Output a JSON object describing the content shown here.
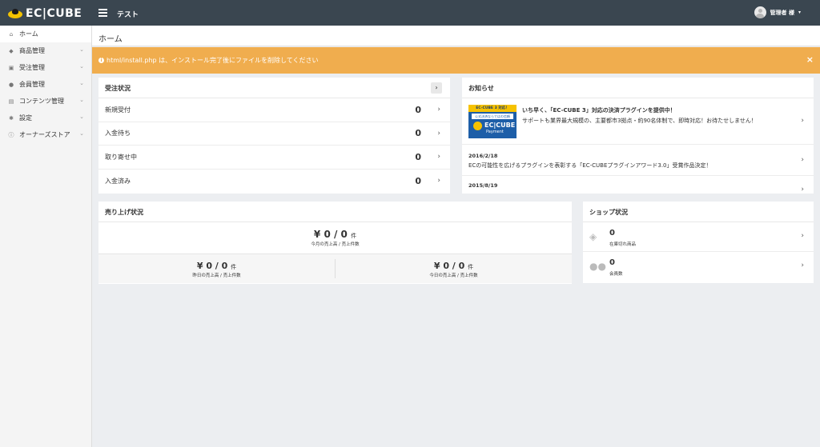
{
  "app": {
    "logo_text": "EC|CUBE",
    "page_label": "テスト"
  },
  "user": {
    "name": "管理者 様"
  },
  "sidebar": {
    "items": [
      {
        "label": "ホーム",
        "icon": "home-icon",
        "glyph": "⌂",
        "active": true,
        "chevron": false
      },
      {
        "label": "商品管理",
        "icon": "tag-icon",
        "glyph": "◆",
        "active": false,
        "chevron": true
      },
      {
        "label": "受注管理",
        "icon": "cart-icon",
        "glyph": "▣",
        "active": false,
        "chevron": true
      },
      {
        "label": "会員管理",
        "icon": "users-icon",
        "glyph": "●",
        "active": false,
        "chevron": true
      },
      {
        "label": "コンテンツ管理",
        "icon": "file-icon",
        "glyph": "▤",
        "active": false,
        "chevron": true
      },
      {
        "label": "設定",
        "icon": "gear-icon",
        "glyph": "✱",
        "active": false,
        "chevron": true
      },
      {
        "label": "オーナーズストア",
        "icon": "info-icon",
        "glyph": "ⓘ",
        "active": false,
        "chevron": true
      }
    ]
  },
  "page": {
    "title": "ホーム"
  },
  "alert": {
    "text": "html/install.php は、インストール完了後にファイルを削除してください",
    "close": "×",
    "color": "#f0ad4e"
  },
  "orders": {
    "title": "受注状況",
    "more": "›",
    "rows": [
      {
        "label": "新規受付",
        "count": "0"
      },
      {
        "label": "入金待ち",
        "count": "0"
      },
      {
        "label": "取り寄せ中",
        "count": "0"
      },
      {
        "label": "入金済み",
        "count": "0"
      }
    ]
  },
  "news": {
    "title": "お知らせ",
    "banner": {
      "line1": "EC-CUBE 3 対応！",
      "line2": "公式決済ならではの信頼",
      "line3": "EC|CUBE",
      "line4": "Payment"
    },
    "items": [
      {
        "title": "いち早く、「EC-CUBE 3」対応の決済プラグインを提供中！",
        "body": "サポートも業界最大規模の、主要都市3拠点・約90名体制で、即時対応！お待たせしません！"
      },
      {
        "date": "2016/2/18",
        "body": "ECの可能性を広げるプラグインを表彰する「EC-CUBEプラグインアワード3.0」受賞作品決定！"
      },
      {
        "date": "2015/8/19",
        "body": ""
      }
    ]
  },
  "sales": {
    "title": "売り上げ状況",
    "month": {
      "value": "¥ 0 / 0",
      "unit": "件",
      "caption": "今月の売上高 / 売上件数"
    },
    "yesterday": {
      "value": "¥ 0 / 0",
      "unit": "件",
      "caption": "昨日の売上高 / 売上件数"
    },
    "today": {
      "value": "¥ 0 / 0",
      "unit": "件",
      "caption": "今日の売上高 / 売上件数"
    }
  },
  "shop": {
    "title": "ショップ状況",
    "rows": [
      {
        "icon": "tags-icon",
        "glyph": "◈",
        "count": "0",
        "label": "在庫切れ商品"
      },
      {
        "icon": "users-group-icon",
        "glyph": "●●",
        "count": "0",
        "label": "会員数"
      }
    ]
  }
}
